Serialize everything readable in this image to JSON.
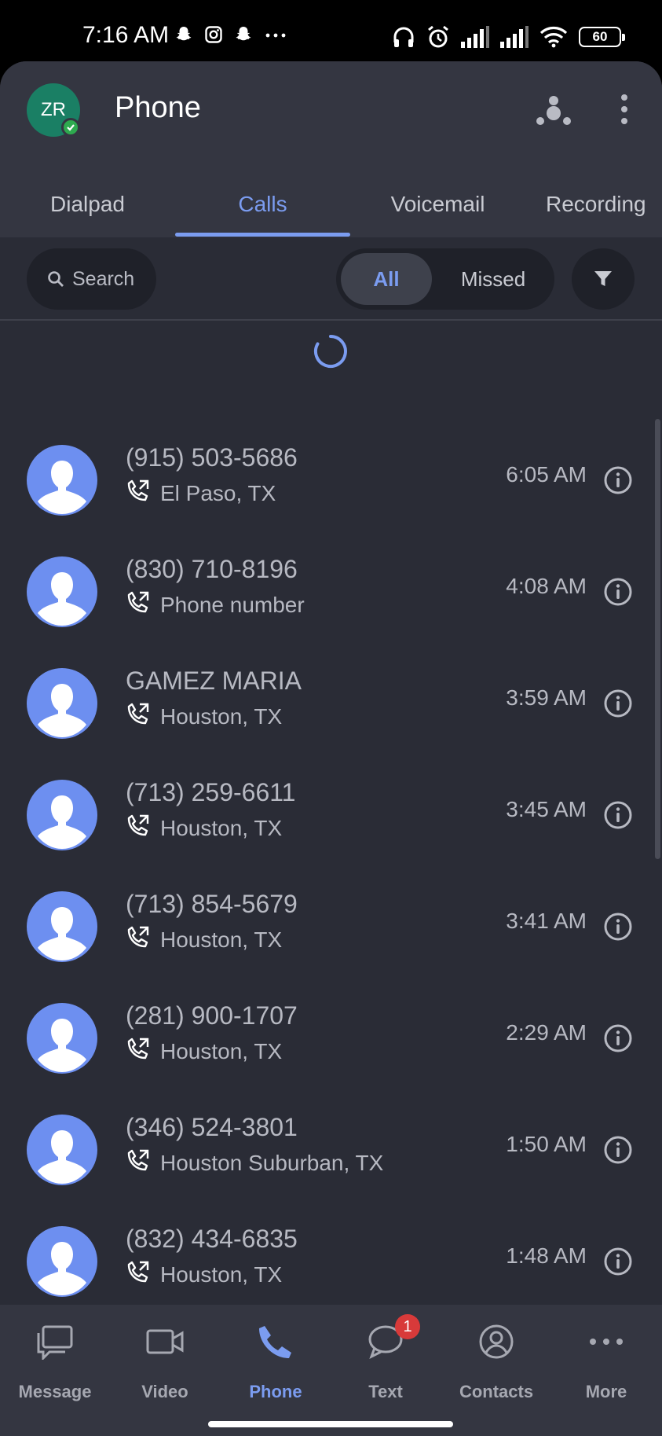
{
  "status_bar": {
    "time": "7:16 AM",
    "left_icons": [
      "snapchat-icon",
      "instagram-icon",
      "snapchat-icon",
      "more-dots-icon"
    ],
    "right_icons": [
      "headphones-icon",
      "alarm-icon",
      "signal-icon",
      "signal-icon",
      "wifi-icon"
    ],
    "battery": "60"
  },
  "header": {
    "avatar_initials": "ZR",
    "title": "Phone"
  },
  "tabs": [
    {
      "label": "Dialpad"
    },
    {
      "label": "Calls"
    },
    {
      "label": "Voicemail"
    },
    {
      "label": "Recording"
    }
  ],
  "active_tab": "Calls",
  "filter": {
    "search_placeholder": "Search",
    "all_label": "All",
    "missed_label": "Missed",
    "selected": "All"
  },
  "calls": [
    {
      "name": "(915) 503-5686",
      "location": "El Paso, TX",
      "time": "6:05 AM",
      "direction": "outgoing"
    },
    {
      "name": "(830) 710-8196",
      "location": "Phone number",
      "time": "4:08 AM",
      "direction": "outgoing"
    },
    {
      "name": "GAMEZ MARIA",
      "location": "Houston, TX",
      "time": "3:59 AM",
      "direction": "outgoing"
    },
    {
      "name": "(713) 259-6611",
      "location": "Houston, TX",
      "time": "3:45 AM",
      "direction": "outgoing"
    },
    {
      "name": "(713) 854-5679",
      "location": "Houston, TX",
      "time": "3:41 AM",
      "direction": "outgoing"
    },
    {
      "name": "(281) 900-1707",
      "location": "Houston, TX",
      "time": "2:29 AM",
      "direction": "outgoing"
    },
    {
      "name": "(346) 524-3801",
      "location": "Houston Suburban, TX",
      "time": "1:50 AM",
      "direction": "outgoing"
    },
    {
      "name": "(832) 434-6835",
      "location": "Houston, TX",
      "time": "1:48 AM",
      "direction": "outgoing"
    }
  ],
  "bottom_nav": [
    {
      "label": "Message",
      "icon": "message-icon"
    },
    {
      "label": "Video",
      "icon": "video-icon"
    },
    {
      "label": "Phone",
      "icon": "phone-icon"
    },
    {
      "label": "Text",
      "icon": "chat-bubble-icon",
      "badge": "1"
    },
    {
      "label": "Contacts",
      "icon": "contacts-icon"
    },
    {
      "label": "More",
      "icon": "more-icon"
    }
  ],
  "active_nav": "Phone",
  "colors": {
    "accent": "#7b9cf0",
    "background": "#2a2c36",
    "header": "#343641",
    "avatar_bg": "#1a7f64",
    "badge": "#d83a3a"
  }
}
